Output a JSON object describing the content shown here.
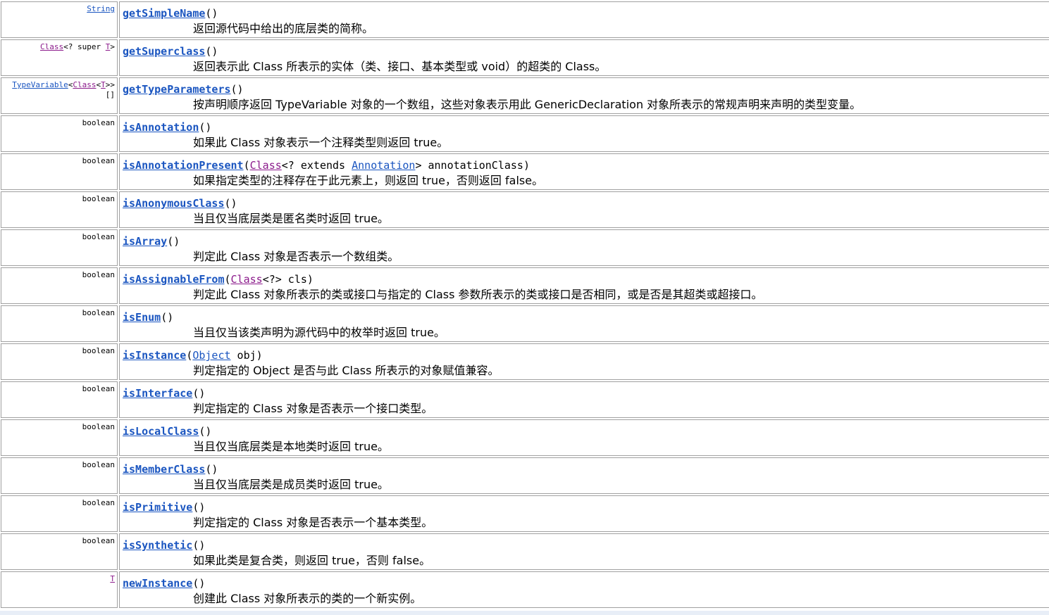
{
  "rows": [
    {
      "type": "String",
      "method": "getSimpleName",
      "params": "()",
      "desc": "返回源代码中给出的底层类的简称。"
    },
    {
      "type_a": "Class",
      "type_b": "<? super ",
      "type_c": "T",
      "type_d": ">",
      "method": "getSuperclass",
      "params": "()",
      "desc": "返回表示此 Class 所表示的实体（类、接口、基本类型或 void）的超类的 Class。"
    },
    {
      "type_a": "TypeVariable",
      "type_b": "<",
      "type_c": "Class",
      "type_d": "<",
      "type_e": "T",
      "type_f": ">>",
      "type_g": "[]",
      "method": "getTypeParameters",
      "params": "()",
      "desc": "按声明顺序返回 TypeVariable 对象的一个数组，这些对象表示用此 GenericDeclaration 对象所表示的常规声明来声明的类型变量。"
    },
    {
      "type": "boolean",
      "method": "isAnnotation",
      "params": "()",
      "desc": "如果此 Class 对象表示一个注释类型则返回 true。"
    },
    {
      "type": "boolean",
      "method": "isAnnotationPresent",
      "p1": "(",
      "p2": "Class",
      "p3": "<? extends ",
      "p4": "Annotation",
      "p5": "> annotationClass)",
      "desc": "如果指定类型的注释存在于此元素上，则返回 true，否则返回 false。"
    },
    {
      "type": "boolean",
      "method": "isAnonymousClass",
      "params": "()",
      "desc": "当且仅当底层类是匿名类时返回 true。"
    },
    {
      "type": "boolean",
      "method": "isArray",
      "params": "()",
      "desc": "判定此 Class 对象是否表示一个数组类。"
    },
    {
      "type": "boolean",
      "method": "isAssignableFrom",
      "p1": "(",
      "p2": "Class",
      "p3": "<?> cls)",
      "desc": "判定此 Class 对象所表示的类或接口与指定的 Class 参数所表示的类或接口是否相同，或是否是其超类或超接口。"
    },
    {
      "type": "boolean",
      "method": "isEnum",
      "params": "()",
      "desc": "当且仅当该类声明为源代码中的枚举时返回 true。"
    },
    {
      "type": "boolean",
      "method": "isInstance",
      "p1": "(",
      "p2": "Object",
      "p3": " obj)",
      "desc": "判定指定的 Object 是否与此 Class 所表示的对象赋值兼容。"
    },
    {
      "type": "boolean",
      "method": "isInterface",
      "params": "()",
      "desc": "判定指定的 Class 对象是否表示一个接口类型。"
    },
    {
      "type": "boolean",
      "method": "isLocalClass",
      "params": "()",
      "desc": "当且仅当底层类是本地类时返回 true。"
    },
    {
      "type": "boolean",
      "method": "isMemberClass",
      "params": "()",
      "desc": "当且仅当底层类是成员类时返回 true。"
    },
    {
      "type": "boolean",
      "method": "isPrimitive",
      "params": "()",
      "desc": "判定指定的 Class 对象是否表示一个基本类型。"
    },
    {
      "type": "boolean",
      "method": "isSynthetic",
      "params": "()",
      "desc": "如果此类是复合类，则返回 true，否则 false。"
    },
    {
      "type": "T",
      "method": "newInstance",
      "params": "()",
      "desc": "创建此 Class 对象所表示的类的一个新实例。"
    }
  ],
  "colors": {
    "method_link": "#1a55c0",
    "class_link": "#8b1a8b",
    "border": "#a0a0a0"
  }
}
